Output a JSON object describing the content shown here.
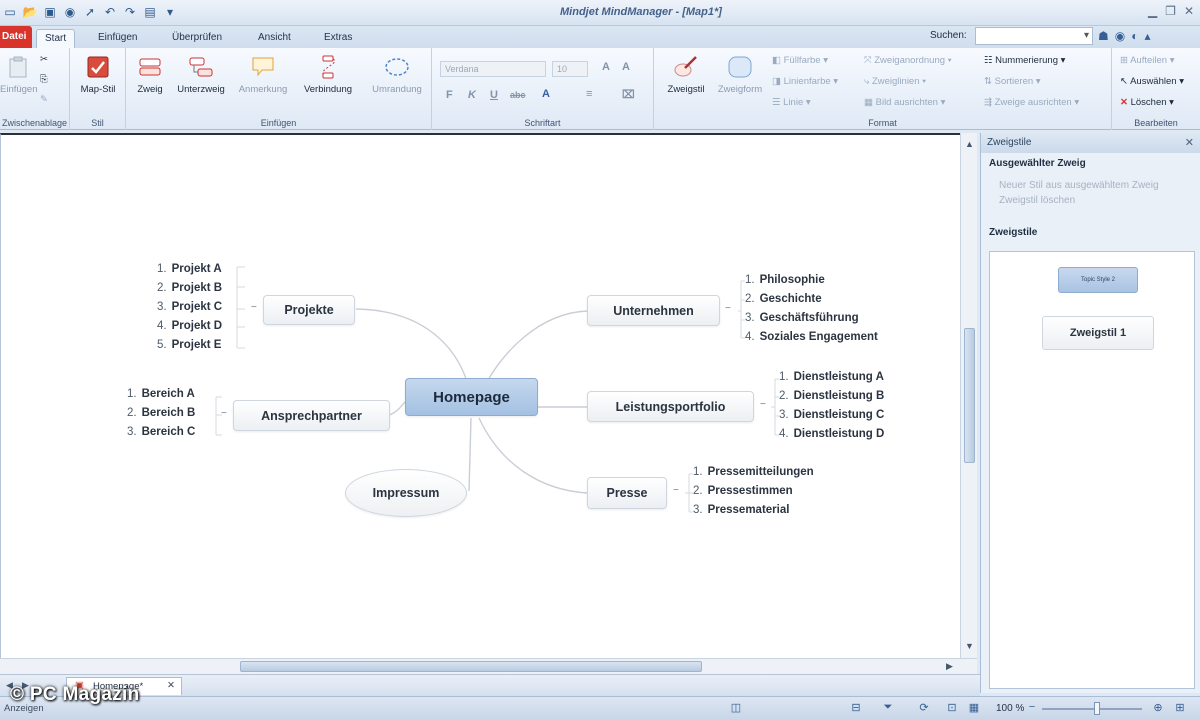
{
  "app": {
    "title": "Mindjet MindManager - [Map1*]",
    "file_tab": "Datei",
    "tabs": [
      "Start",
      "Einfügen",
      "Überprüfen",
      "Ansicht",
      "Extras"
    ],
    "search_label": "Suchen:",
    "search_value": ""
  },
  "ribbon": {
    "clipboard": {
      "label": "Zwischenablage",
      "paste": "Einfügen"
    },
    "style": {
      "label": "Stil",
      "map_style": "Map-Stil"
    },
    "insert": {
      "label": "Einfügen",
      "branch": "Zweig",
      "subbranch": "Unterzweig",
      "callout": "Anmerkung",
      "relationship": "Verbindung",
      "boundary": "Umrandung"
    },
    "font": {
      "label": "Schriftart",
      "font_name": "Verdana",
      "font_size": "10",
      "bold": "F",
      "italic": "K",
      "underline": "U",
      "strike": "abc"
    },
    "format": {
      "label": "Format",
      "branch_style": "Zweigstil",
      "branch_shape": "Zweigform",
      "fill_color": "Füllfarbe",
      "line_color": "Linienfarbe",
      "line": "Linie",
      "branch_order": "Zweiganordnung",
      "branch_align": "Zweiglinien",
      "image_align": "Bild ausrichten",
      "numbering": "Nummerierung",
      "sort": "Sortieren",
      "show_branches": "Zweige ausrichten"
    },
    "edit": {
      "label": "Bearbeiten",
      "expand": "Aufteilen",
      "select": "Auswählen",
      "delete": "Löschen"
    }
  },
  "map": {
    "central": "Homepage",
    "branches": [
      {
        "label": "Projekte",
        "items": [
          "Projekt A",
          "Projekt B",
          "Projekt C",
          "Projekt D",
          "Projekt E"
        ]
      },
      {
        "label": "Ansprechpartner",
        "items": [
          "Bereich A",
          "Bereich B",
          "Bereich C"
        ]
      },
      {
        "label": "Impressum",
        "items": []
      },
      {
        "label": "Unternehmen",
        "items": [
          "Philosophie",
          "Geschichte",
          "Geschäftsführung",
          "Soziales Engagement"
        ]
      },
      {
        "label": "Leistungsportfolio",
        "items": [
          "Dienstleistung A",
          "Dienstleistung B",
          "Dienstleistung C",
          "Dienstleistung D"
        ]
      },
      {
        "label": "Presse",
        "items": [
          "Pressemitteilungen",
          "Pressestimmen",
          "Pressematerial"
        ]
      }
    ]
  },
  "pane": {
    "title": "Zweigstile",
    "selected_header": "Ausgewählter Zweig",
    "link_new_style": "Neuer Stil aus ausgewähltem Zweig",
    "link_delete_style": "Zweigstil löschen",
    "styles_header": "Zweigstile",
    "topic_style_chip": "Topic Style 2",
    "style_card": "Zweigstil 1"
  },
  "document_tab": "Homepage*",
  "status": {
    "text": "Anzeigen",
    "zoom": "100 %",
    "zoom_level_percent": 100
  },
  "watermark": "© PC Magazin"
}
